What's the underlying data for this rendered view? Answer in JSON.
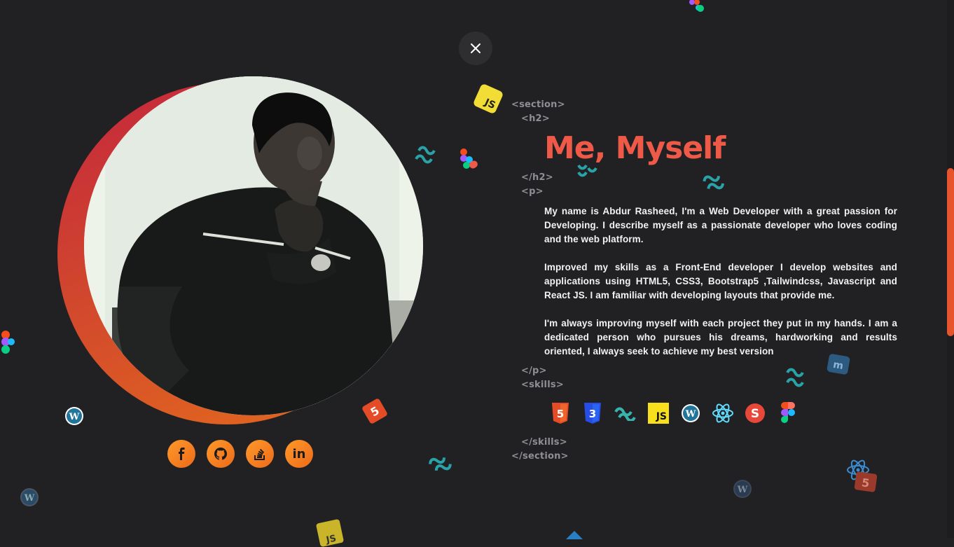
{
  "close": {
    "label": "×"
  },
  "profile": {
    "photo_alt": "Portrait photo of Abdur Rasheed"
  },
  "social": [
    {
      "icon": "facebook-icon",
      "glyph": "f"
    },
    {
      "icon": "github-icon",
      "glyph": ""
    },
    {
      "icon": "stackoverflow-icon",
      "glyph": ""
    },
    {
      "icon": "linkedin-icon",
      "glyph": "in"
    }
  ],
  "code": {
    "section_open": "<section>",
    "h2_open": "<h2>",
    "h2_close": "</h2>",
    "p_open": "<p>",
    "p_close": "</p>",
    "skills_open": "<skills>",
    "skills_close": "</skills>",
    "section_close": "</section>"
  },
  "about": {
    "title": "Me, Myself",
    "paragraphs": [
      "My name is Abdur Rasheed, I'm a Web Developer with a great passion for Developing. I describe myself as a passionate developer who loves coding and the web platform.",
      "Improved my skills as a Front-End developer I develop websites and applications using HTML5, CSS3, Bootstrap5 ,Tailwindcss, Javascript and React JS. I am familiar with developing layouts that provide me.",
      "I'm always improving myself with each project they put in my hands. I am a dedicated person who pursues his dreams, hardworking and results oriented, I always seek to achieve my best version"
    ]
  },
  "skills": [
    {
      "icon": "html5-icon",
      "text": "5"
    },
    {
      "icon": "css3-icon",
      "text": "3"
    },
    {
      "icon": "tailwind-icon",
      "text": ""
    },
    {
      "icon": "javascript-icon",
      "text": "JS"
    },
    {
      "icon": "wordpress-icon",
      "text": "W"
    },
    {
      "icon": "react-icon",
      "text": ""
    },
    {
      "icon": "sass-icon",
      "text": "S"
    },
    {
      "icon": "figma-icon",
      "text": ""
    }
  ],
  "colors": {
    "background": "#212124",
    "accent": "#ef5a48",
    "orange": "#f28a1f",
    "tag": "#8e8e93"
  }
}
